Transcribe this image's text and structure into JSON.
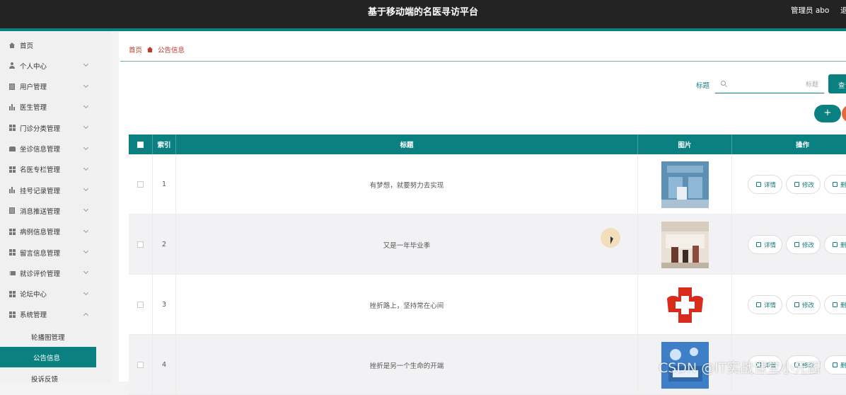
{
  "header": {
    "title": "基于移动端的名医寻访平台",
    "user": "管理员 abo",
    "logout": "退"
  },
  "sidebar": {
    "items": [
      {
        "label": "首页",
        "icon": "home-icon"
      },
      {
        "label": "个人中心",
        "icon": "person-icon"
      },
      {
        "label": "用户管理",
        "icon": "document-icon"
      },
      {
        "label": "医生管理",
        "icon": "bars-icon"
      },
      {
        "label": "门诊分类管理",
        "icon": "grid-icon"
      },
      {
        "label": "坐诊信息管理",
        "icon": "cup-icon"
      },
      {
        "label": "名医专栏管理",
        "icon": "grid-icon"
      },
      {
        "label": "挂号记录管理",
        "icon": "bars-icon"
      },
      {
        "label": "消息推送管理",
        "icon": "document-icon"
      },
      {
        "label": "病例信息管理",
        "icon": "grid-icon"
      },
      {
        "label": "留言信息管理",
        "icon": "grid-icon"
      },
      {
        "label": "就诊评价管理",
        "icon": "film-icon"
      },
      {
        "label": "论坛中心",
        "icon": "grid-icon"
      },
      {
        "label": "系统管理",
        "icon": "grid-icon"
      }
    ],
    "sub_items": [
      {
        "label": "轮播图管理"
      },
      {
        "label": "公告信息",
        "active": true
      },
      {
        "label": "投诉反馈"
      }
    ]
  },
  "breadcrumb": {
    "home": "首页",
    "current": "公告信息"
  },
  "search": {
    "label": "标题",
    "placeholder": "标题",
    "button": "查询"
  },
  "actions": {
    "add": "+"
  },
  "table": {
    "headers": [
      "索引",
      "标题",
      "图片",
      "操作"
    ],
    "rows": [
      {
        "index": "1",
        "title": "有梦想，就要努力去实现",
        "image": "hospital-corridor-photo"
      },
      {
        "index": "2",
        "title": "又是一年毕业季",
        "image": "hospital-lobby-photo"
      },
      {
        "index": "3",
        "title": "挫折路上，坚持常在心间",
        "image": "red-cross-logo"
      },
      {
        "index": "4",
        "title": "挫折是另一个生命的开端",
        "image": "blue-ward-photo"
      }
    ],
    "op_labels": {
      "detail": "详情",
      "edit": "修改",
      "delete": "删除"
    }
  },
  "watermark": "CSDN @IT实战课堂小元酱",
  "colors": {
    "teal": "#0a8080",
    "topbar": "#232323",
    "breadcrumb": "#c0392b",
    "delete_btn": "#e4683a"
  }
}
